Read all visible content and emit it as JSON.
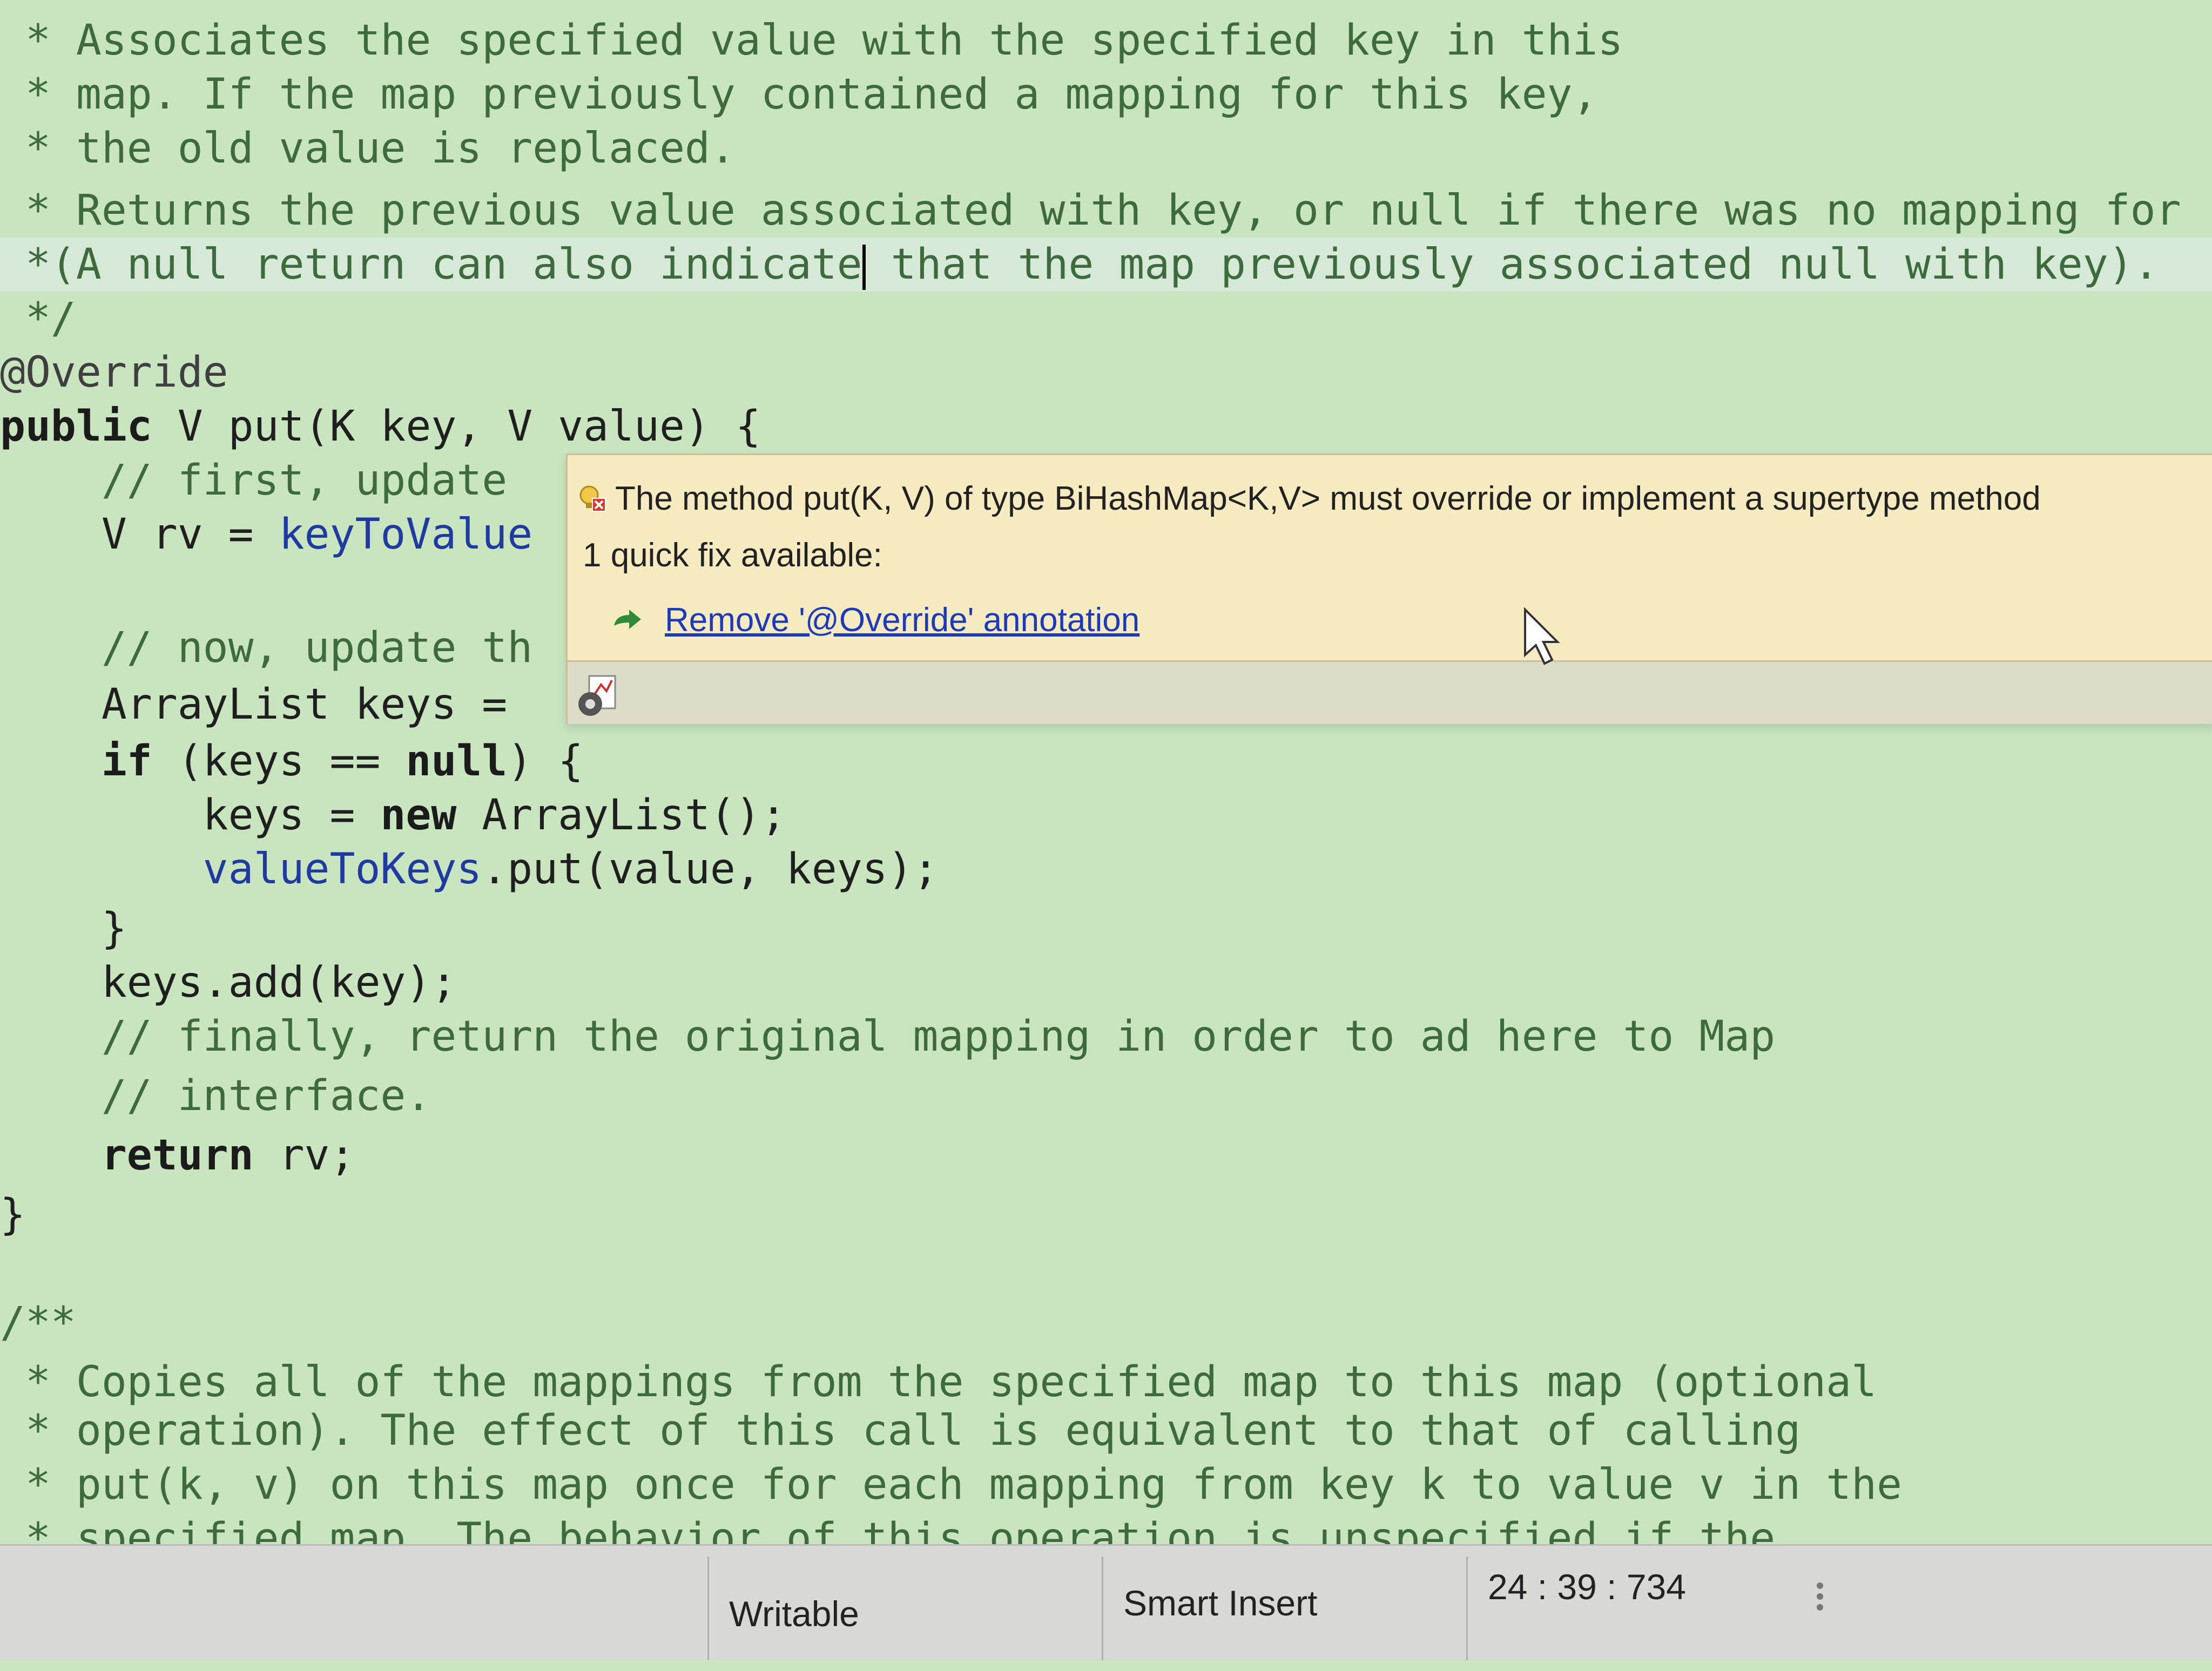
{
  "code_lines": [
    {
      "text": " * Associates the specified value with the specified key in this",
      "cls": "doc"
    },
    {
      "text": " * map. If the map previously contained a mapping for this key,",
      "cls": "doc"
    },
    {
      "text": " * the old value is replaced.",
      "cls": "doc"
    },
    {
      "text": " * Returns the previous value associated with key, or null if there was no mapping for",
      "cls": "doc"
    },
    {
      "text_before_cursor": " *(A null return can also indicate",
      "text_after_cursor": " that the map previously associated null with key).",
      "cls": "doc",
      "highlighted": true
    },
    {
      "text": " */",
      "cls": "doc"
    },
    {
      "text": "@Override",
      "cls": "anno"
    },
    {
      "kw": "public",
      "rest": " V put(K key, V value) {"
    },
    {
      "text": "    // first, update",
      "cls": "comment"
    },
    {
      "text_plain": "    V rv = ",
      "text_field": "keyToValue"
    },
    {
      "text": "",
      "cls": "plain"
    },
    {
      "text": "    // now, update th",
      "cls": "comment"
    },
    {
      "text": "    ArrayList keys = ",
      "cls": "plain"
    },
    {
      "pre": "    ",
      "kw": "if",
      "rest_a": " (keys == ",
      "kw2": "null",
      "rest_b": ") {"
    },
    {
      "pre": "        keys = ",
      "kw": "new",
      "rest": " ArrayList();"
    },
    {
      "text_field": "        valueToKeys",
      "text_plain": ".put(value, keys);"
    },
    {
      "text": "    }",
      "cls": "plain"
    },
    {
      "text": "    keys.add(key);",
      "cls": "plain"
    },
    {
      "text": "    // finally, return the original mapping in order to ad here to Map",
      "cls": "comment"
    },
    {
      "text": "    // interface.",
      "cls": "comment"
    },
    {
      "pre": "    ",
      "kw": "return",
      "rest": " rv;"
    },
    {
      "text": "}",
      "cls": "plain"
    },
    {
      "text": "",
      "cls": "plain"
    },
    {
      "text": "/**",
      "cls": "doc"
    },
    {
      "text": " * Copies all of the mappings from the specified map to this map (optional",
      "cls": "doc"
    },
    {
      "text": " * operation). The effect of this call is equivalent to that of calling",
      "cls": "doc"
    },
    {
      "text": " * put(k, v) on this map once for each mapping from key k to value v in the",
      "cls": "doc"
    },
    {
      "text": " * specified map. The behavior of this operation is unspecified if the",
      "cls": "doc"
    }
  ],
  "popup": {
    "message": "The method put(K, V) of type BiHashMap<K,V> must override or implement a supertype method",
    "quick_fix_count": "1 quick fix available:",
    "fix_label": "Remove '@Override' annotation",
    "error_icon": "error-lightbulb-icon",
    "fix_icon": "quick-fix-arrow-icon",
    "footer_icon": "settings-icon"
  },
  "status_bar": {
    "writable": "Writable",
    "insert_mode": "Smart Insert",
    "position": "24 : 39 : 734"
  },
  "colors": {
    "editor_bg": "#c8e5bf",
    "popup_bg": "#f6ebc0",
    "link": "#1d3ab8"
  }
}
